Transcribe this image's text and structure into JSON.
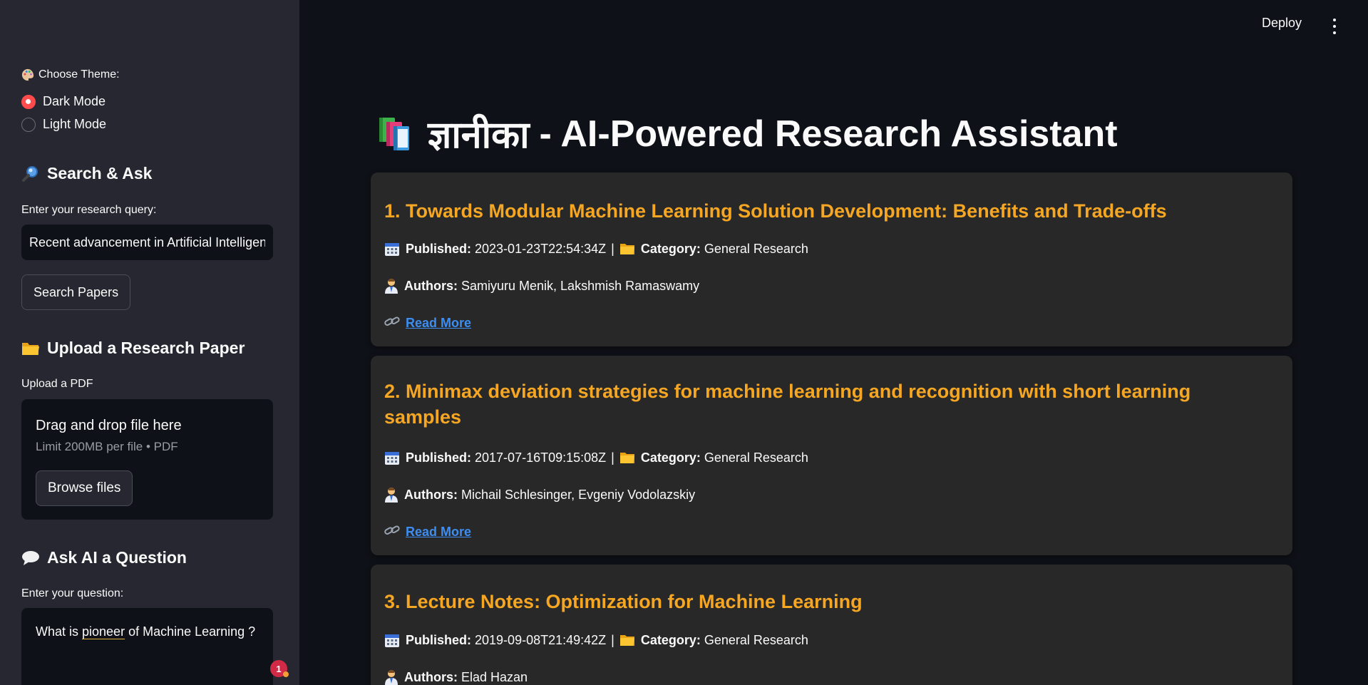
{
  "app": {
    "title_word": "ज्ञानीका",
    "title_rest": "- AI-Powered Research Assistant",
    "deploy_label": "Deploy"
  },
  "sidebar": {
    "theme_label": "Choose Theme:",
    "theme_options": [
      "Dark Mode",
      "Light Mode"
    ],
    "theme_selected": "Dark Mode",
    "search_heading": "Search & Ask",
    "query_label": "Enter your research query:",
    "query_value": "Recent advancement in Artificial Intelligence",
    "search_button": "Search Papers",
    "upload_heading": "Upload a Research Paper",
    "upload_label": "Upload a PDF",
    "dropzone_title": "Drag and drop file here",
    "dropzone_sub": "Limit 200MB per file • PDF",
    "browse_button": "Browse files",
    "ask_heading": "Ask AI a Question",
    "question_label": "Enter your question:",
    "question_pre": "What is ",
    "question_flagged": "pioneer",
    "question_post": " of Machine Learning ?",
    "notification_count": "1"
  },
  "papers": [
    {
      "title": "1. Towards Modular Machine Learning Solution Development: Benefits and Trade-offs",
      "published_label": "Published:",
      "published": "2023-01-23T22:54:34Z",
      "category_label": "Category:",
      "category": "General Research",
      "authors_label": "Authors:",
      "authors": "Samiyuru Menik, Lakshmish Ramaswamy",
      "link_label": "Read More"
    },
    {
      "title": "2. Minimax deviation strategies for machine learning and recognition with short learning samples",
      "published_label": "Published:",
      "published": "2017-07-16T09:15:08Z",
      "category_label": "Category:",
      "category": "General Research",
      "authors_label": "Authors:",
      "authors": "Michail Schlesinger, Evgeniy Vodolazskiy",
      "link_label": "Read More"
    },
    {
      "title": "3. Lecture Notes: Optimization for Machine Learning",
      "published_label": "Published:",
      "published": "2019-09-08T21:49:42Z",
      "category_label": "Category:",
      "category": "General Research",
      "authors_label": "Authors:",
      "authors": "Elad Hazan",
      "link_label": "Read More"
    }
  ],
  "colors": {
    "accent": "#ff4b4b",
    "paper_title": "#f5a623",
    "link": "#3d8ef0",
    "sidebar_bg": "#262730",
    "main_bg": "#0e1117"
  },
  "icons": {
    "theme": "palette-icon",
    "search": "magnifier-icon",
    "upload": "folder-icon",
    "ask": "speech-bubble-icon",
    "title": "books-icon",
    "published": "calendar-icon",
    "category": "folder-icon",
    "authors": "person-icon",
    "link": "link-icon"
  }
}
